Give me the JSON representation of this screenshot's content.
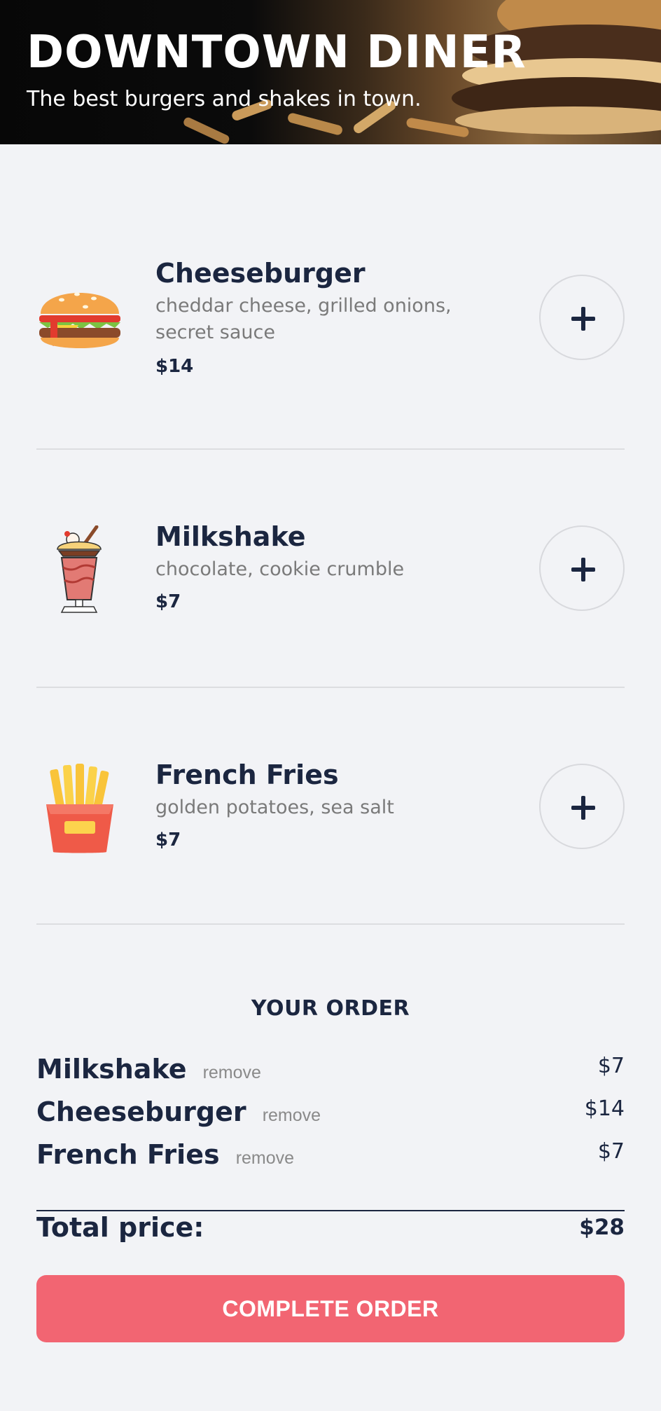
{
  "header": {
    "title": "DOWNTOWN DINER",
    "subtitle": "The best burgers and shakes in town."
  },
  "menu": [
    {
      "name": "Cheeseburger",
      "description": "cheddar cheese, grilled onions, secret sauce",
      "price": "$14",
      "icon": "burger-icon",
      "add_icon": "plus-icon"
    },
    {
      "name": "Milkshake",
      "description": "chocolate, cookie crumble",
      "price": "$7",
      "icon": "milkshake-icon",
      "add_icon": "plus-icon"
    },
    {
      "name": "French Fries",
      "description": "golden potatoes, sea salt",
      "price": "$7",
      "icon": "fries-icon",
      "add_icon": "plus-icon"
    }
  ],
  "order": {
    "title": "YOUR ORDER",
    "remove_label": "remove",
    "items": [
      {
        "name": "Milkshake",
        "price": "$7"
      },
      {
        "name": "Cheeseburger",
        "price": "$14"
      },
      {
        "name": "French Fries",
        "price": "$7"
      }
    ],
    "total_label": "Total price:",
    "total_value": "$28",
    "complete_label": "COMPLETE ORDER"
  },
  "colors": {
    "background": "#f2f3f6",
    "text": "#1b2640",
    "muted": "#7a7a7a",
    "accent": "#f26572"
  }
}
